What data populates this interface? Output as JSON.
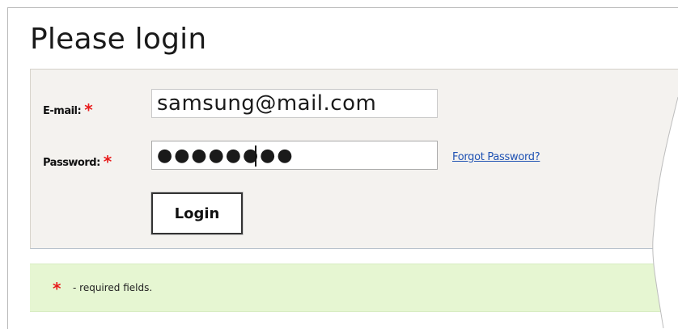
{
  "page": {
    "title": "Please login"
  },
  "form": {
    "email_label": "E-mail:",
    "email_value": "samsung@mail.com",
    "password_label": "Password:",
    "password_value": "●●●●●●●●",
    "required_marker": "*",
    "forgot_link": "Forgot Password?",
    "login_button": "Login"
  },
  "info": {
    "required_marker": "*",
    "required_text": "- required fields."
  },
  "colors": {
    "required": "#e81c1c",
    "link": "#1f52b3",
    "panel": "#f4f2ef",
    "info_bar": "#e6f6d2"
  }
}
